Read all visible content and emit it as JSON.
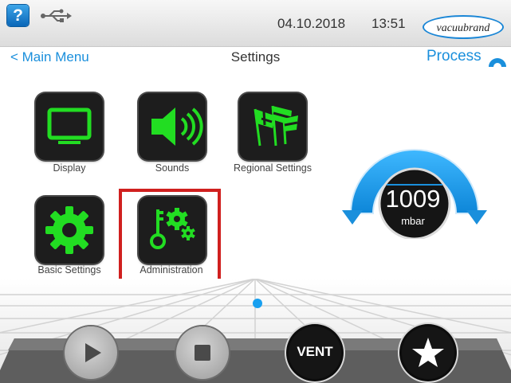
{
  "header": {
    "help_label": "?",
    "date": "04.10.2018",
    "time": "13:51",
    "logo_text": "vacuubrand"
  },
  "nav": {
    "back_label": "< Main Menu",
    "title": "Settings",
    "process_label": "Process"
  },
  "tiles": [
    {
      "label": "Display",
      "icon": "monitor-icon"
    },
    {
      "label": "Sounds",
      "icon": "speaker-icon"
    },
    {
      "label": "Regional Settings",
      "icon": "flags-icon"
    },
    {
      "label": "Basic Settings",
      "icon": "gear-icon"
    },
    {
      "label": "Administration",
      "icon": "key-gears-icon"
    }
  ],
  "gauge": {
    "value": "1009",
    "unit": "mbar"
  },
  "controls": {
    "vent_label": "VENT"
  },
  "colors": {
    "accent": "#1a8fdc",
    "icon_green": "#22dd22",
    "highlight": "#d0201f"
  }
}
